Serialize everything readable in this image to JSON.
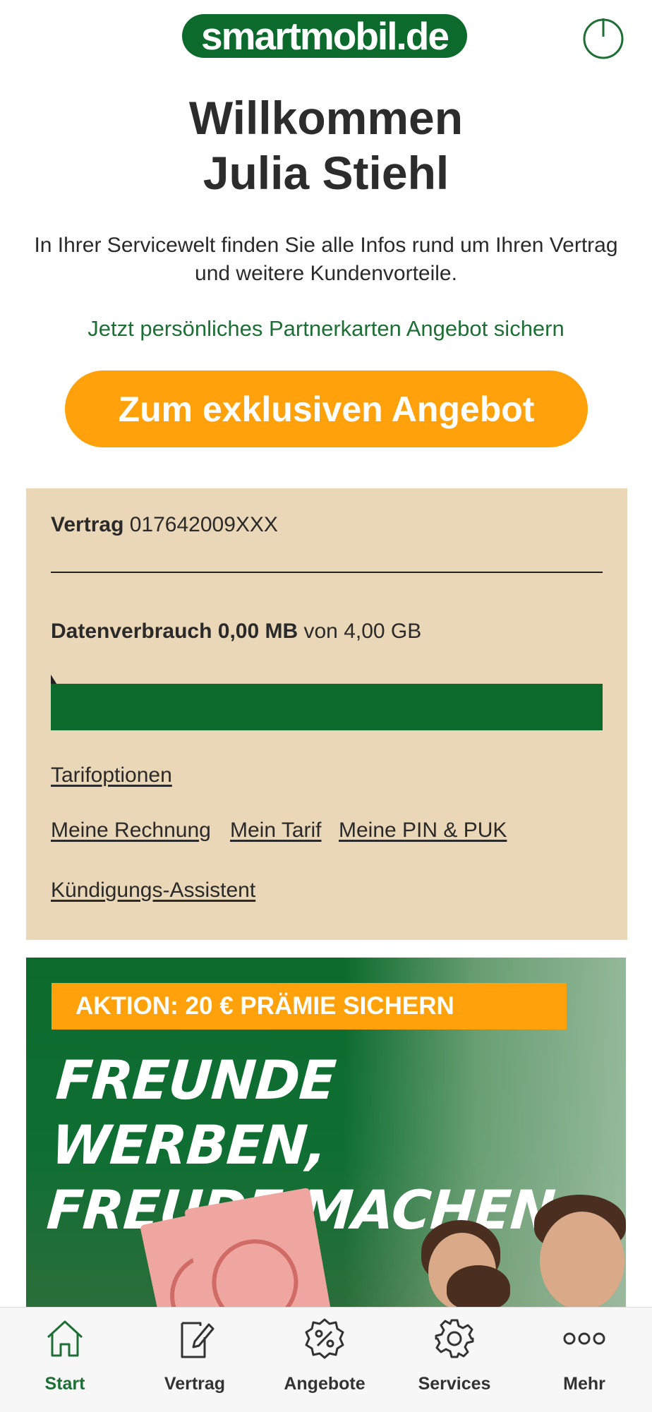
{
  "header": {
    "logo_text": "smartmobil.de",
    "logo_color": "#0c6a2c",
    "power_icon": "power-icon"
  },
  "welcome": {
    "line1": "Willkommen",
    "line2": "Julia Stiehl",
    "intro": "In Ihrer Servicewelt finden Sie alle Infos rund um Ihren Vertrag und weitere Kundenvorteile.",
    "partner_link": "Jetzt persönliches Partnerkarten Angebot sichern",
    "cta_label": "Zum exklusiven Angebot",
    "cta_color": "#ffa10a"
  },
  "contract": {
    "label": "Vertrag",
    "number": "017642009XXX",
    "usage_label": "Datenverbrauch",
    "usage_value": "0,00 MB",
    "usage_of": "von 4,00 GB",
    "usage_fraction_remaining": 1.0,
    "links": {
      "tarifoptionen": "Tarifoptionen",
      "rechnung": "Meine Rechnung",
      "tarif": "Mein Tarif",
      "pin_puk": "Meine PIN & PUK",
      "kuendigung": "Kündigungs-Assistent"
    },
    "card_color": "#ead7b7"
  },
  "promo": {
    "badge": "AKTION: 20 € PRÄMIE SICHERN",
    "headline_line1": "FREUNDE WERBEN,",
    "headline_line2": "FREUDE MACHEN"
  },
  "nav": {
    "items": [
      {
        "label": "Start",
        "icon": "home-icon",
        "active": true
      },
      {
        "label": "Vertrag",
        "icon": "contract-icon",
        "active": false
      },
      {
        "label": "Angebote",
        "icon": "percent-badge-icon",
        "active": false
      },
      {
        "label": "Services",
        "icon": "gear-icon",
        "active": false
      },
      {
        "label": "Mehr",
        "icon": "more-dots-icon",
        "active": false
      }
    ],
    "active_color": "#1d6f35"
  }
}
